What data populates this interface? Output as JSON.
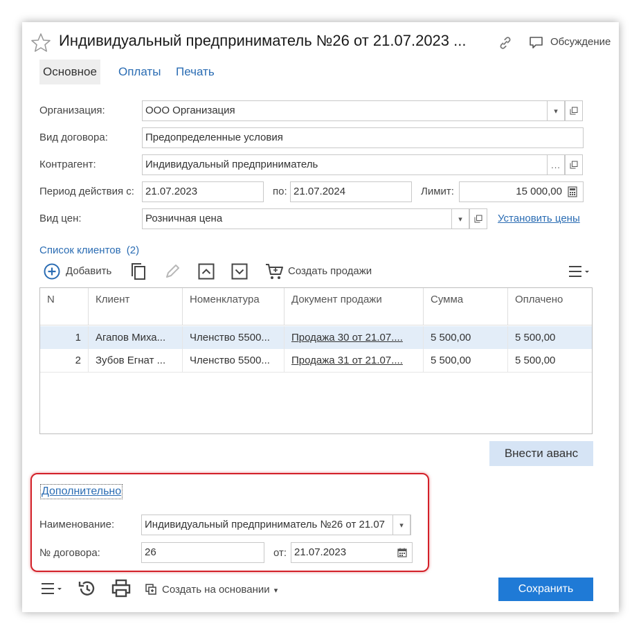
{
  "header": {
    "title": "Индивидуальный предприниматель №26 от 21.07.2023 ...",
    "discussion_label": "Обсуждение"
  },
  "tabs": [
    {
      "label": "Основное",
      "active": true
    },
    {
      "label": "Оплаты",
      "active": false
    },
    {
      "label": "Печать",
      "active": false
    }
  ],
  "form": {
    "organization": {
      "label": "Организация:",
      "value": "ООО Организация"
    },
    "contract_type": {
      "label": "Вид договора:",
      "value": "Предопределенные условия"
    },
    "counterparty": {
      "label": "Контрагент:",
      "value": "Индивидуальный предприниматель"
    },
    "period": {
      "label": "Период действия с:",
      "from": "21.07.2023",
      "to_label": "по:",
      "to": "21.07.2024"
    },
    "limit": {
      "label": "Лимит:",
      "value": "15 000,00"
    },
    "price_type": {
      "label": "Вид цен:",
      "value": "Розничная цена",
      "set_prices_link": "Установить цены"
    }
  },
  "clients": {
    "section_title": "Список клиентов",
    "count": "(2)",
    "toolbar": {
      "add_label": "Добавить",
      "create_sales_label": "Создать продажи"
    },
    "columns": [
      "N",
      "Клиент",
      "Номенклатура",
      "Документ продажи",
      "Сумма",
      "Оплачено"
    ],
    "rows": [
      {
        "n": "1",
        "client": "Агапов Миха...",
        "item": "Членство 5500...",
        "doc": "Продажа 30 от 21.07....",
        "sum": "5 500,00",
        "paid": "5 500,00",
        "selected": true
      },
      {
        "n": "2",
        "client": "Зубов Егнат ...",
        "item": "Членство 5500...",
        "doc": "Продажа 31 от 21.07....",
        "sum": "5 500,00",
        "paid": "5 500,00",
        "selected": false
      }
    ],
    "advance_button": "Внести аванс"
  },
  "additional": {
    "link": "Дополнительно",
    "name": {
      "label": "Наименование:",
      "value": "Индивидуальный предприниматель №26 от 21.07"
    },
    "number": {
      "label": "№ договора:",
      "value": "26",
      "date_label": "от:",
      "date": "21.07.2023"
    }
  },
  "footer": {
    "create_based_label": "Создать на основании",
    "save_label": "Сохранить"
  }
}
